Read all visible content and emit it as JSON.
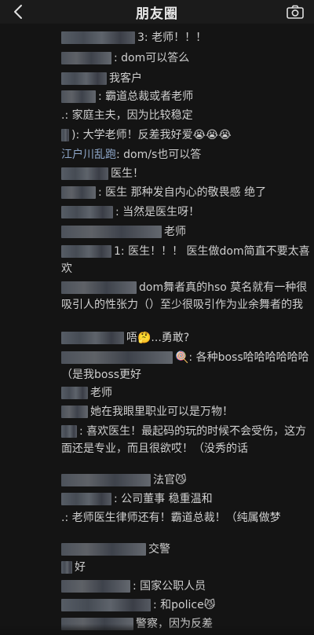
{
  "header": {
    "title": "朋友圈"
  },
  "comments": [
    {
      "name": "",
      "text": "3: 老师！！！"
    },
    {
      "name": "",
      "text": ": dom可以答么"
    },
    {
      "name": "",
      "text": "我客户"
    },
    {
      "name": "",
      "text": ": 霸道总裁或者老师"
    },
    {
      "name": "",
      "text": ".: 家庭主夫，因为比较稳定"
    },
    {
      "name": "",
      "text": "): 大学老师！反差我好爱😭😭😭"
    },
    {
      "name": "江户川乱跑",
      "text": ": dom/s也可以答"
    },
    {
      "name": "",
      "text": "医生！"
    },
    {
      "name": "",
      "text": ": 医生 那种发自内心的敬畏感 绝了"
    },
    {
      "name": "",
      "text": ": 当然是医生呀！"
    },
    {
      "name": "",
      "text": "老师"
    },
    {
      "name": "",
      "text": "1: 医生！！！ 医生做dom简直不要太喜欢"
    },
    {
      "name": "",
      "text": "dom舞者真的hso 莫名就有一种很吸引人的性张力（）至少很吸引作为业余舞者的我"
    },
    {
      "name": "",
      "text": "唔🤔...勇敢?"
    },
    {
      "name": "",
      "text": "🍭: 各种boss哈哈哈哈哈哈（是我boss更好"
    },
    {
      "name": "",
      "text": "老师"
    },
    {
      "name": "",
      "text": "她在我眼里职业可以是万物！"
    },
    {
      "name": "",
      "text": ": 喜欢医生！最起码的玩的时候不会受伤，这方面还是专业，而且很欲哎！（没秀的话"
    },
    {
      "name": "",
      "text": "法官😼"
    },
    {
      "name": "",
      "text": ": 公司董事 稳重温和"
    },
    {
      "name": "",
      "text": ".: 老师医生律师还有！霸道总裁！（纯属做梦"
    },
    {
      "name": "",
      "text": "交警"
    },
    {
      "name": "",
      "text": "好"
    },
    {
      "name": "",
      "text": ": 国家公职人员"
    },
    {
      "name": "",
      "text": ": 和police😼"
    },
    {
      "name": "",
      "text": "警察，因为反差"
    }
  ]
}
